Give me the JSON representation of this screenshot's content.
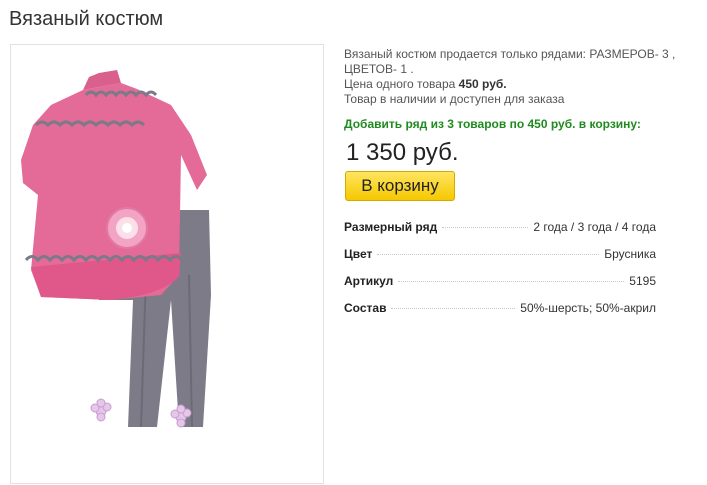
{
  "product": {
    "title": "Вязаный костюм",
    "description_line1": "Вязаный костюм продается только рядами: РАЗМЕРОВ- 3 ,",
    "description_line2": "ЦВЕТОВ- 1 .",
    "unit_price_label": "Цена одного товара",
    "unit_price": "450 руб.",
    "availability": "Товар в наличии и доступен для заказа",
    "promo_text": "Добавить ряд из 3 товаров по 450 руб. в корзину:",
    "total_price": "1 350 руб.",
    "cart_button": "В корзину"
  },
  "specs": [
    {
      "key": "Размерный ряд",
      "value": "2 года / 3 года / 4 года"
    },
    {
      "key": "Цвет",
      "value": "Брусника"
    },
    {
      "key": "Артикул",
      "value": "5195"
    },
    {
      "key": "Состав",
      "value": "50%-шерсть; 50%-акрил"
    }
  ],
  "colors": {
    "accent_green": "#1f8a1f",
    "button_yellow": "#f5c800",
    "sweater_pink": "#e46a98",
    "leggings_gray": "#7d7b88"
  }
}
